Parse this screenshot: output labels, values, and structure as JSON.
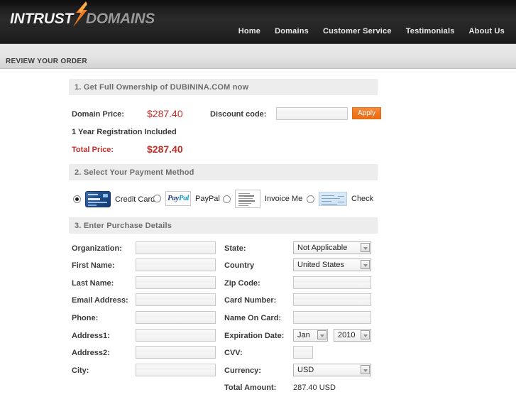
{
  "header": {
    "logo": {
      "part1": "INTRUST",
      "mark": "orange-arrow-icon",
      "part2": "DOMAINS"
    },
    "nav": [
      {
        "label": "Home"
      },
      {
        "label": "Domains"
      },
      {
        "label": "Customer Service"
      },
      {
        "label": "Testimonials"
      },
      {
        "label": "About Us"
      }
    ]
  },
  "page_title": "REVIEW YOUR ORDER",
  "section1": {
    "heading": "1. Get Full Ownership of DUBININA.COM now",
    "domain_price_label": "Domain Price:",
    "domain_price_value": "$287.40",
    "registration_note": "1 Year Registration Included",
    "total_price_label": "Total Price:",
    "total_price_value": "$287.40",
    "discount_label": "Discount code:",
    "discount_value": "",
    "discount_placeholder": "",
    "apply_label": "Apply"
  },
  "section2": {
    "heading": "2. Select Your Payment Method",
    "options": [
      {
        "label": "Credit Card",
        "icon": "credit-card-icon",
        "selected": true
      },
      {
        "label": "PayPal",
        "icon": "paypal-icon",
        "selected": false
      },
      {
        "label": "Invoice Me",
        "icon": "invoice-icon",
        "selected": false
      },
      {
        "label": "Check",
        "icon": "check-icon",
        "selected": false
      }
    ]
  },
  "section3": {
    "heading": "3. Enter Purchase Details",
    "left_fields": [
      {
        "label": "Organization:",
        "value": ""
      },
      {
        "label": "First Name:",
        "value": ""
      },
      {
        "label": "Last Name:",
        "value": ""
      },
      {
        "label": "Email Address:",
        "value": ""
      },
      {
        "label": "Phone:",
        "value": ""
      },
      {
        "label": "Address1:",
        "value": ""
      },
      {
        "label": "Address2:",
        "value": ""
      },
      {
        "label": "City:",
        "value": ""
      }
    ],
    "right_fields": [
      {
        "label": "State:",
        "type": "select",
        "value": "Not Applicable"
      },
      {
        "label": "Country",
        "type": "select",
        "value": "United States"
      },
      {
        "label": "Zip Code:",
        "type": "text",
        "value": ""
      },
      {
        "label": "Card Number:",
        "type": "text",
        "value": ""
      },
      {
        "label": "Name On Card:",
        "type": "text",
        "value": ""
      },
      {
        "label": "Expiration Date:",
        "type": "date",
        "month": "Jan",
        "year": "2010"
      },
      {
        "label": "CVV:",
        "type": "text-small",
        "value": ""
      },
      {
        "label": "Currency:",
        "type": "select",
        "value": "USD"
      },
      {
        "label": "Total Amount:",
        "type": "static",
        "value": "287.40 USD"
      }
    ]
  },
  "colors": {
    "accent_orange": "#ef7622",
    "price_red": "#c0302b",
    "header_dark": "#2a2a2a",
    "section_bar": "#ededed"
  }
}
